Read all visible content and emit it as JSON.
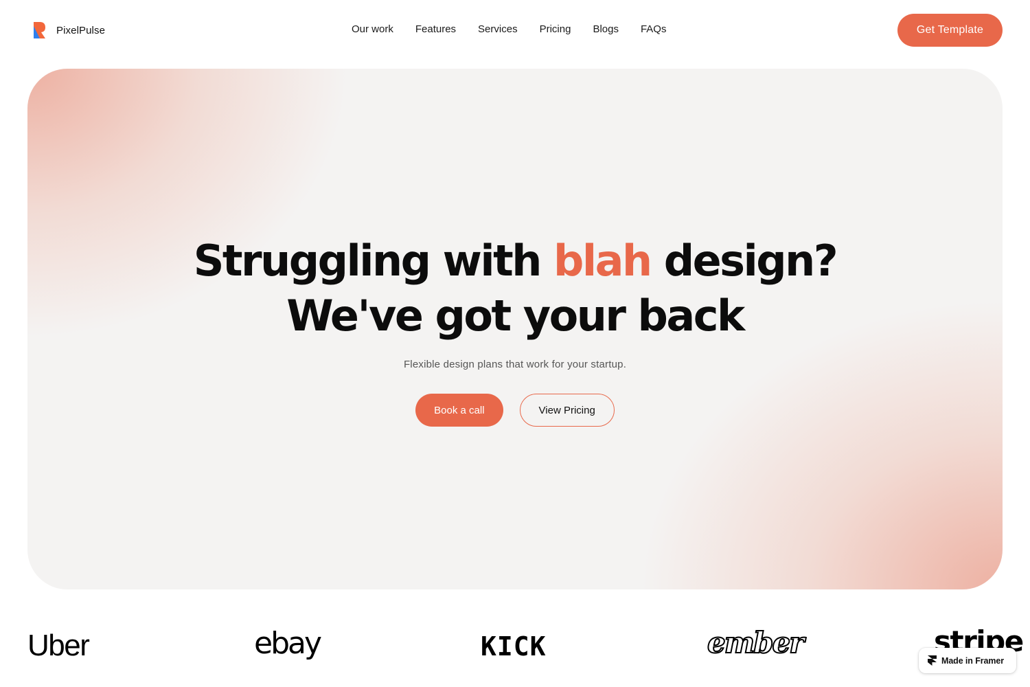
{
  "brand": {
    "name": "PixelPulse",
    "logo_icon": "pixelpulse-logo-icon"
  },
  "nav": {
    "items": [
      {
        "label": "Our work"
      },
      {
        "label": "Features"
      },
      {
        "label": "Services"
      },
      {
        "label": "Pricing"
      },
      {
        "label": "Blogs"
      },
      {
        "label": "FAQs"
      }
    ],
    "cta_label": "Get Template"
  },
  "hero": {
    "title_part1": "Struggling with ",
    "title_accent": "blah",
    "title_part2": " design?",
    "title_line2": "We've got your back",
    "subtitle": "Flexible design plans that work for your startup.",
    "primary_button": "Book a call",
    "secondary_button": "View Pricing"
  },
  "logos": [
    {
      "name": "Uber"
    },
    {
      "name": "ebay"
    },
    {
      "name": "KICK"
    },
    {
      "name": "ember"
    },
    {
      "name": "stripe"
    }
  ],
  "badge": {
    "label": "Made in Framer",
    "icon": "framer-icon"
  },
  "colors": {
    "accent": "#e8684a",
    "hero_background": "#f4f3f2",
    "hero_glow": "#eca594",
    "text": "#111111"
  }
}
